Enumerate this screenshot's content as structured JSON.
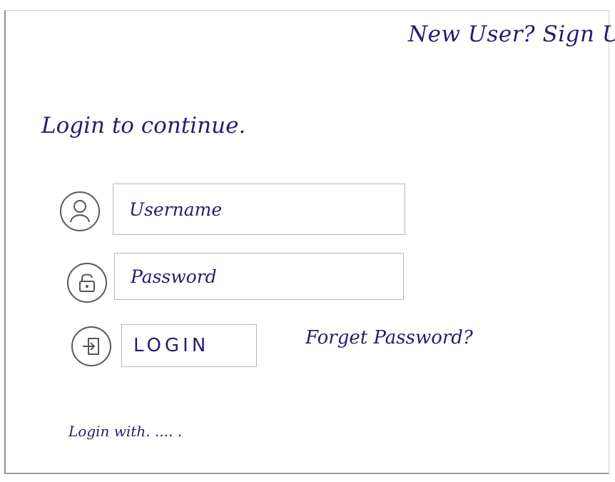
{
  "header": {
    "signup_label": "New User? Sign Up."
  },
  "main": {
    "title": "Login to continue."
  },
  "form": {
    "username_placeholder": "Username",
    "password_placeholder": "Password",
    "login_label": "LOGIN",
    "forgot_label": "Forget Password?"
  },
  "footer": {
    "login_with_label": "Login with. .... ."
  },
  "icons": {
    "username": "user-icon",
    "password": "unlock-icon",
    "login": "login-icon"
  },
  "colors": {
    "ink": "#2a1a6e",
    "frame": "#8f8f8f",
    "field_border": "#b8b8b8"
  }
}
